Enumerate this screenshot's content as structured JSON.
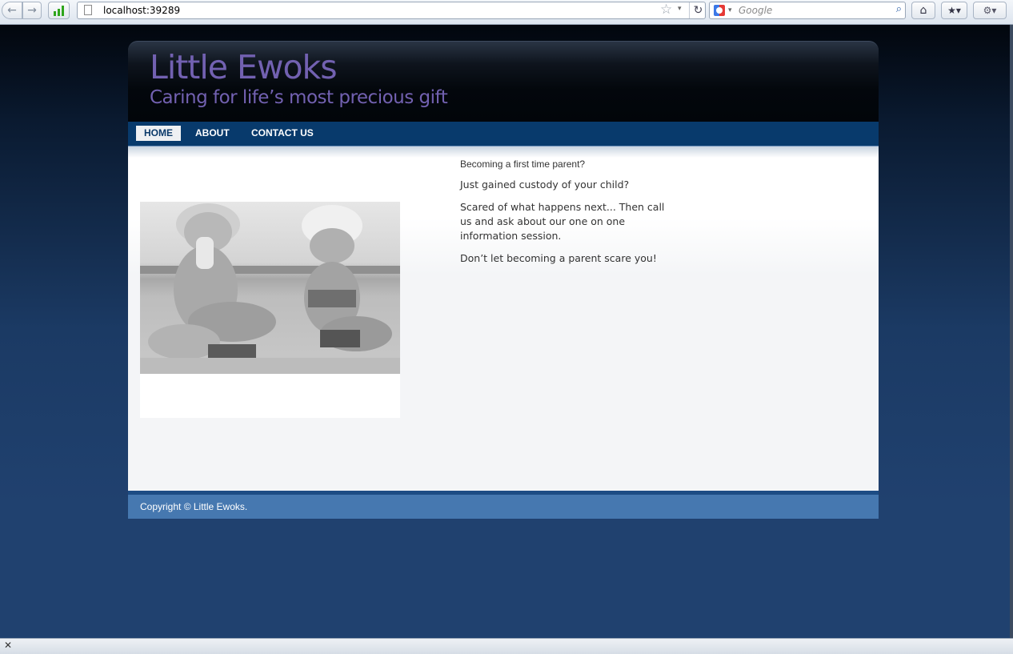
{
  "browser": {
    "url": "localhost:39289",
    "search_placeholder": "Google"
  },
  "site": {
    "title": "Little Ewoks",
    "tagline": "Caring for life’s most precious gift"
  },
  "menu": {
    "items": [
      {
        "label": "HOME",
        "selected": true
      },
      {
        "label": "ABOUT",
        "selected": false
      },
      {
        "label": "CONTACT US",
        "selected": false
      }
    ]
  },
  "content": {
    "paragraphs": [
      "Becoming a first time parent?",
      "Just gained custody of your child?",
      "Scared of what happens next... Then call us and ask about our one on one information session.",
      "Don’t let becoming a parent scare you!"
    ]
  },
  "footer": {
    "copyright": "Copyright © Little Ewoks."
  }
}
